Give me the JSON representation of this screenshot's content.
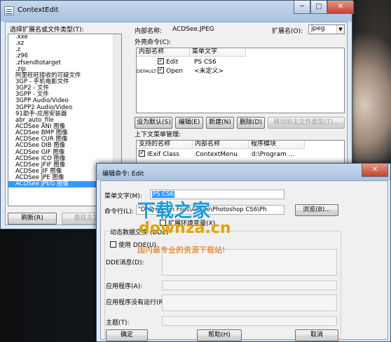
{
  "main_window": {
    "title": "ContextEdit",
    "caption": {
      "minimize": "─",
      "maximize": "□",
      "close": "✕"
    },
    "ext_list_label": "选择扩展名或文件类型(T):",
    "ext_list": [
      ".xxe",
      ".xz",
      ".z",
      ".z96",
      ".zfsendtotarget",
      ".zip",
      "阿里旺旺接收的可疑文件",
      "3GP - 手机电影文件",
      "3GP2 - 文件",
      "3GPP - 文件",
      "3GPP Audio/Video",
      "3GPP2 Audio/Video",
      "91助手-应用安装器",
      "abr_auto_file",
      "ACDSee ANI 图像",
      "ACDSee BMP 图像",
      "ACDSee CUR 图像",
      "ACDSee DIB 图像",
      "ACDSee GIF 图像",
      "ACDSee ICO 图像",
      "ACDSee JFIF 图像",
      "ACDSee JIF 图像",
      "ACDSee JPE 图像",
      "ACDSee JPEG 图像"
    ],
    "selected_index": 23,
    "refresh_button": "刷新(R)",
    "find_button": "查找主文件",
    "internal_name_label": "内部名称:",
    "internal_name_value": "ACDSee.JPEG",
    "ext_label": "扩展名(O):",
    "ext_value": "jpeg",
    "shell_label": "外壳命令(C):",
    "shell_headers": [
      "内部名称",
      "菜单文字"
    ],
    "shell_rows": [
      {
        "prefix": "",
        "name": "Edit",
        "menu": "PS CS6"
      },
      {
        "prefix": "DEFAULT",
        "name": "Open",
        "menu": "<未定义>"
      }
    ],
    "shell_buttons": [
      "设为默认(S)",
      "编辑(E)",
      "新建(N)",
      "删除(D)",
      "移动到主文件类型(T)..."
    ],
    "context_label": "上下文菜单管理:",
    "context_headers": [
      "支持的名称",
      "内部名称",
      "程序模块"
    ],
    "context_rows": [
      {
        "name": "IExif Class",
        "internal": "ContextMenu",
        "module": "d:\\Program ..."
      }
    ]
  },
  "edit_dialog": {
    "title": "编辑命令: Edit",
    "close": "✕",
    "menu_text_label": "菜单文字(M):",
    "menu_text_value": "PS CS6",
    "command_label": "命令行(L):",
    "command_value": "\"D:\\Program Files\\Adobe\\Photoshop CS6\\Ph",
    "browse_button": "浏览(B)...",
    "expand_env_label": "扩展环境变量(X)",
    "dde_group_label": "动态数据交换 (DDE)",
    "use_dde_label": "使用 DDE(U)",
    "dde_message_label": "DDE消息(D):",
    "app_label": "应用程序(A):",
    "app_not_running_label": "应用程序没有运行(R):",
    "topic_label": "主题(T):",
    "ok_button": "确定",
    "help_button": "帮助(H)",
    "cancel_button": "取消"
  },
  "watermark": {
    "line1": "下载之家",
    "line2": "downza.cn",
    "line3": "国内最专业的资源下载站!"
  }
}
